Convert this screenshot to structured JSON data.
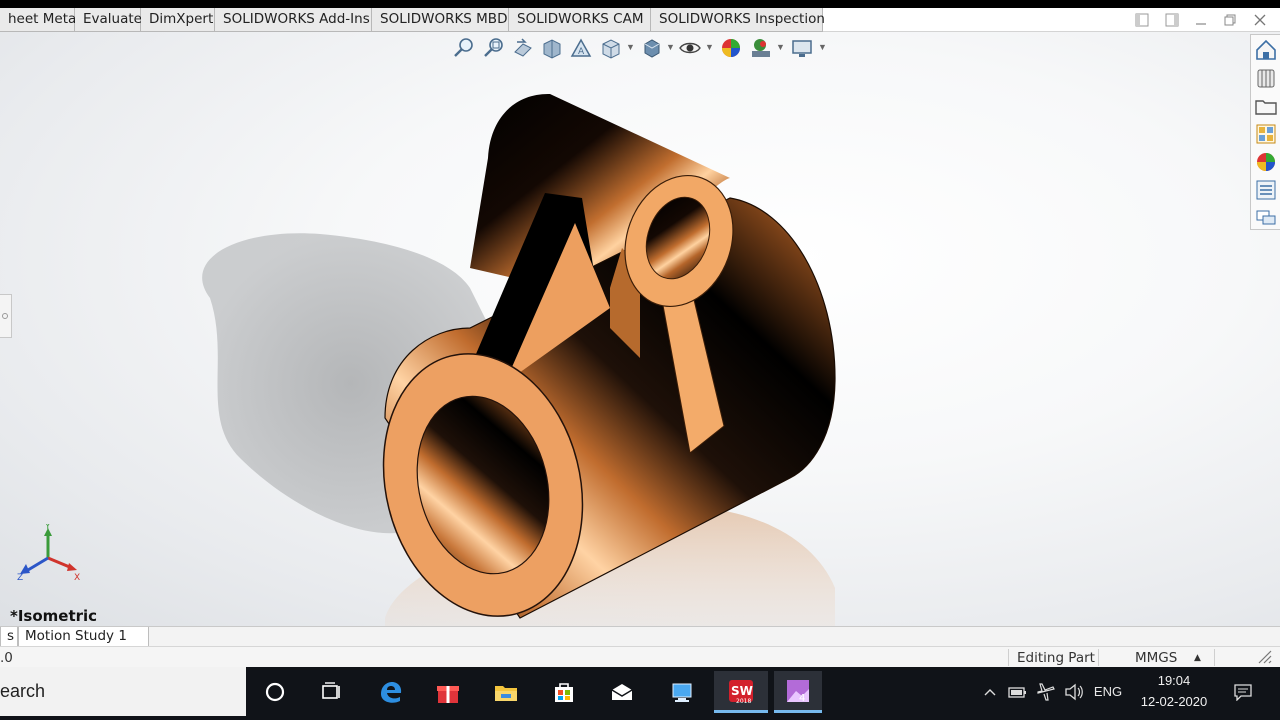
{
  "command_tabs": [
    {
      "label": "heet Metal"
    },
    {
      "label": "Evaluate"
    },
    {
      "label": "DimXpert"
    },
    {
      "label": "SOLIDWORKS Add-Ins"
    },
    {
      "label": "SOLIDWORKS MBD"
    },
    {
      "label": "SOLIDWORKS CAM"
    },
    {
      "label": "SOLIDWORKS Inspection"
    }
  ],
  "viewport": {
    "view_name": "*Isometric",
    "part_color": "#c87a3c",
    "triad": {
      "x": "X",
      "y": "Y",
      "z": "Z"
    }
  },
  "heads_up_toolbar": [
    "zoom-to-fit-icon",
    "zoom-to-area-icon",
    "previous-view-icon",
    "section-view-icon",
    "dynamic-annotation-icon",
    "view-orientation-icon",
    "display-style-icon",
    "hide-show-items-icon",
    "edit-appearance-icon",
    "apply-scene-icon",
    "view-settings-icon"
  ],
  "task_pane": [
    "solidworks-resources-icon",
    "design-library-icon",
    "file-explorer-icon",
    "view-palette-icon",
    "appearances-icon",
    "custom-properties-icon",
    "forum-icon"
  ],
  "bottom_tabs": [
    {
      "label": "s"
    },
    {
      "label": "Motion Study 1"
    }
  ],
  "status_bar": {
    "left": ".0",
    "mode": "Editing Part",
    "units": "MMGS",
    "units_caret": "▲"
  },
  "taskbar": {
    "search_text": "earch",
    "tray_language": "ENG",
    "time": "19:04",
    "date": "12-02-2020",
    "sw_badge": "2018"
  }
}
